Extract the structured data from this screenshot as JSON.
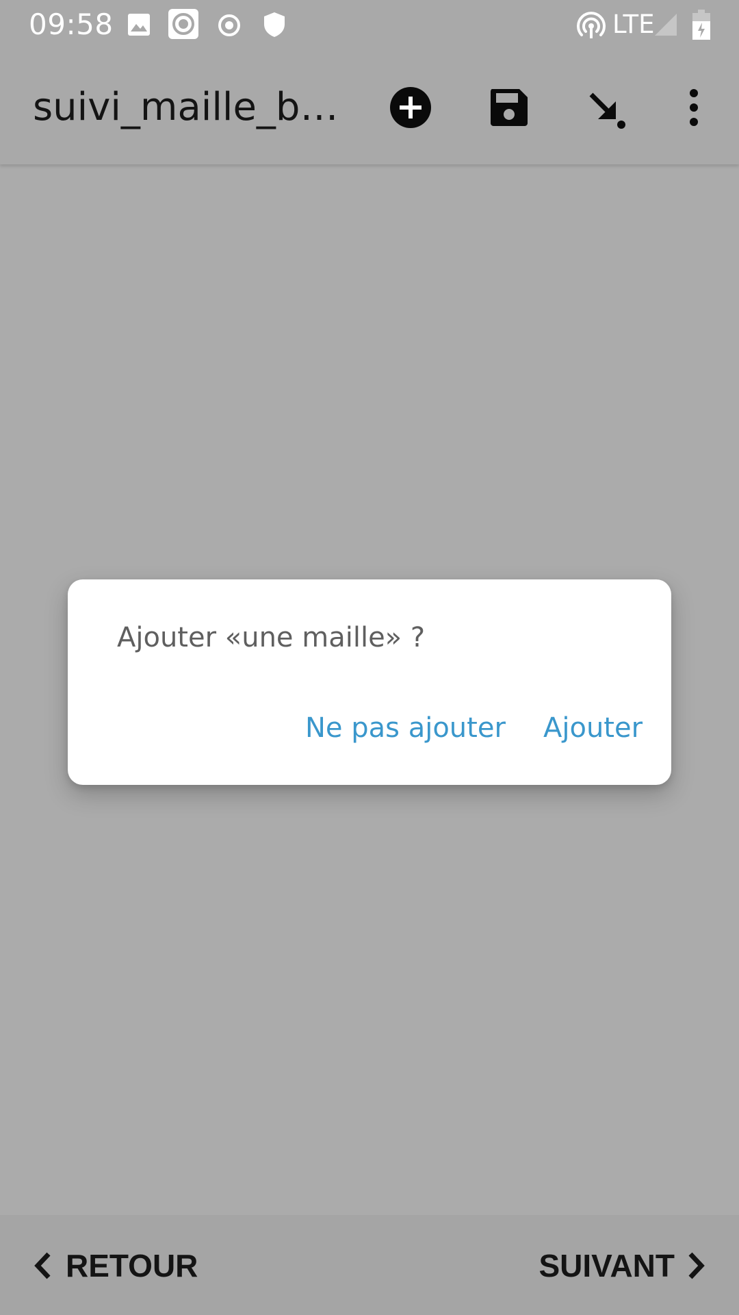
{
  "status_bar": {
    "time": "09:58",
    "network_label": "LTE",
    "icons": [
      "image-icon",
      "record-icon",
      "target-icon",
      "shield-icon",
      "hotspot-icon",
      "signal-icon",
      "battery-charging-icon"
    ]
  },
  "app_bar": {
    "title": "suivi_maille_b…",
    "actions": [
      "add-circle-icon",
      "save-icon",
      "download-arrow-icon",
      "more-vert-icon"
    ]
  },
  "dialog": {
    "message": "Ajouter «une maille» ?",
    "negative_label": "Ne pas ajouter",
    "positive_label": "Ajouter"
  },
  "bottom_nav": {
    "back_label": "RETOUR",
    "next_label": "SUIVANT"
  },
  "colors": {
    "dialog_button": "#3a97cc",
    "scrim_background": "#ababab",
    "dialog_background": "#ffffff"
  }
}
